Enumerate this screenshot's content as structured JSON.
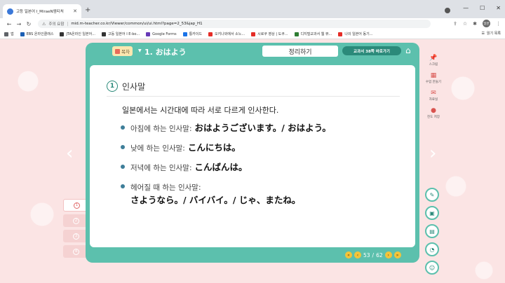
{
  "browser": {
    "tab_title": "고등 일본어 I_MiraeN엠티처",
    "url_security": "주의 요함",
    "url": "mid.m-teacher.co.kr/Viewer/common/ui/ui.html?page=2_53&jap_H1",
    "profile": "일반",
    "bookmarks": [
      {
        "label": "앱",
        "color": "#5f6368"
      },
      {
        "label": "EBS 온라인클래스",
        "color": "#1b5fb4"
      },
      {
        "label": "JTA온라인 일본어...",
        "color": "#333333"
      },
      {
        "label": "고등 일본어 I E-bo...",
        "color": "#333333"
      },
      {
        "label": "Google Forms",
        "color": "#673ab7"
      },
      {
        "label": "통카이드",
        "color": "#1a73e8"
      },
      {
        "label": "오키나와에서 소노...",
        "color": "#e52d27"
      },
      {
        "label": "시로쿠 영상 | 도쿠...",
        "color": "#e52d27"
      },
      {
        "label": "디지털교과서 웹 뷰...",
        "color": "#2e7d32"
      },
      {
        "label": "나의 일본어 동기...",
        "color": "#e52d27"
      }
    ],
    "reading_list": "읽기 목록"
  },
  "header": {
    "toc_label": "목차",
    "lesson_title": "1. おはよう",
    "summary_label": "정리하기",
    "textbook_link": "교과서 38쪽 바로가기"
  },
  "content": {
    "section_number": "1",
    "section_title": "인사말",
    "intro": "일본에서는 시간대에 따라 서로 다르게 인사한다.",
    "items": [
      {
        "label": "아침에 하는 인사말:",
        "jp": "おはようございます。/ おはよう。"
      },
      {
        "label": "낮에 하는 인사말:",
        "jp": "こんにちは。"
      },
      {
        "label": "저녁에 하는 인사말:",
        "jp": "こんばんは。"
      },
      {
        "label": "헤어질 때 하는 인사말:",
        "jp": "さようなら。/ バイバイ。/ じゃ、またね。"
      }
    ]
  },
  "pager": {
    "current": "53",
    "total": "62"
  },
  "left_nav": [
    "1",
    "2",
    "3",
    "4"
  ],
  "right_tools": [
    {
      "label": "스크립",
      "icon": "pin-icon"
    },
    {
      "label": "수업 만들기",
      "icon": "folder-icon"
    },
    {
      "label": "자료실",
      "icon": "mail-icon"
    },
    {
      "label": "진도 저장",
      "icon": "location-icon"
    }
  ]
}
